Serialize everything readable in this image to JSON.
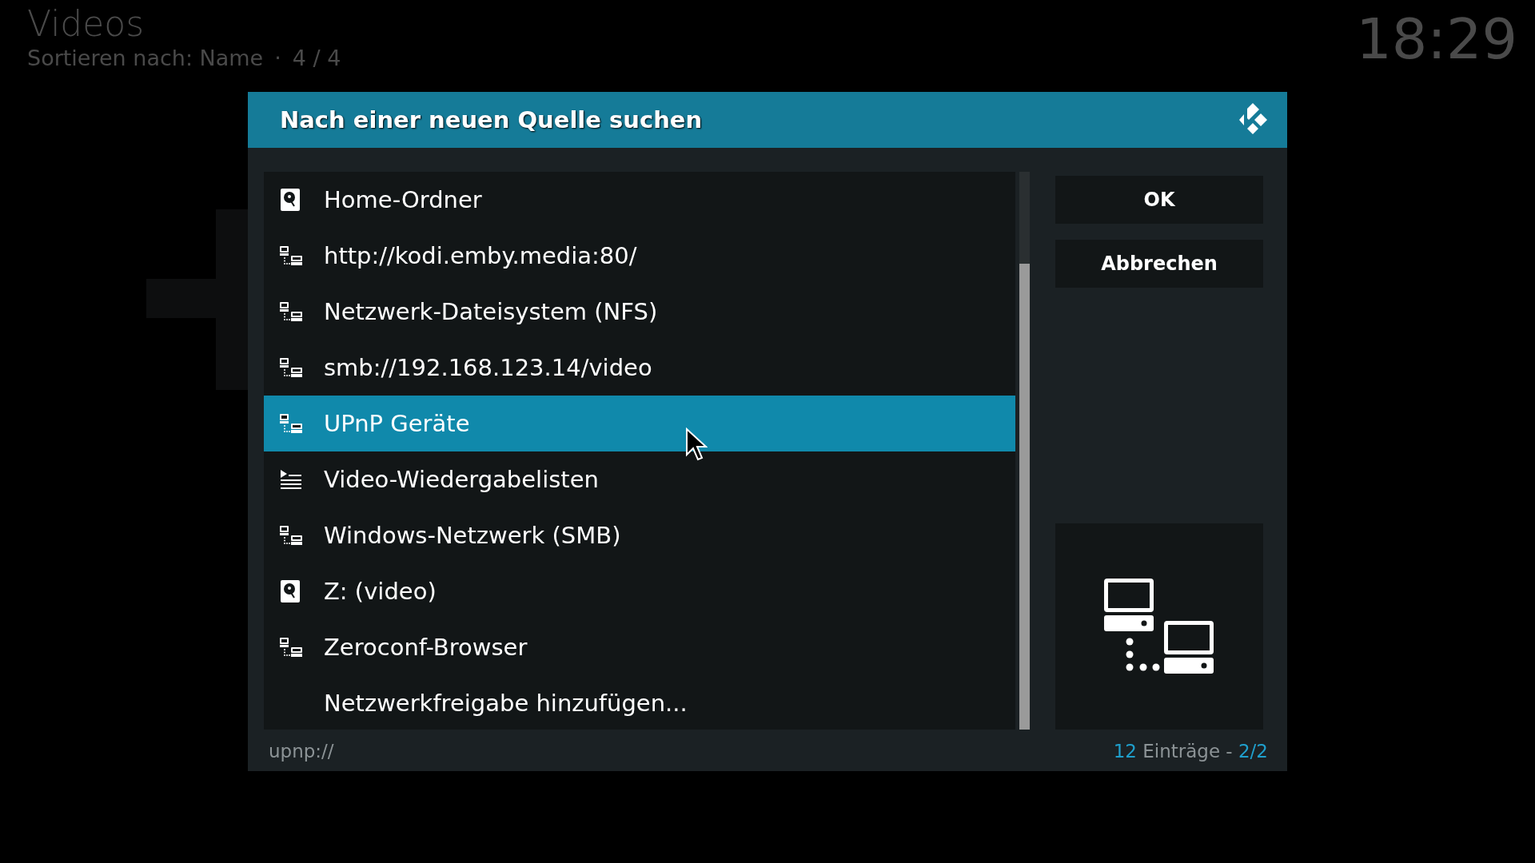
{
  "header": {
    "title": "Videos",
    "sort": "Sortieren nach: Name",
    "separator": "·",
    "position": "4 / 4",
    "clock": "18:29"
  },
  "dialog": {
    "title": "Nach einer neuen Quelle suchen",
    "items": [
      {
        "label": "Home-Ordner",
        "kind": "drive",
        "selected": false
      },
      {
        "label": "http://kodi.emby.media:80/",
        "kind": "network",
        "selected": false
      },
      {
        "label": "Netzwerk-Dateisystem (NFS)",
        "kind": "network",
        "selected": false
      },
      {
        "label": "smb://192.168.123.14/video",
        "kind": "network",
        "selected": false
      },
      {
        "label": "UPnP Geräte",
        "kind": "network",
        "selected": true
      },
      {
        "label": "Video-Wiedergabelisten",
        "kind": "playlist",
        "selected": false
      },
      {
        "label": "Windows-Netzwerk (SMB)",
        "kind": "network",
        "selected": false
      },
      {
        "label": "Z: (video)",
        "kind": "drive",
        "selected": false
      },
      {
        "label": "Zeroconf-Browser",
        "kind": "network",
        "selected": false
      },
      {
        "label": "Netzwerkfreigabe hinzufügen...",
        "kind": "none",
        "selected": false
      }
    ],
    "buttons": [
      "OK",
      "Abbrechen"
    ],
    "path": "upnp://",
    "count": "12",
    "count_label": "Einträge -",
    "page": "2/2"
  }
}
